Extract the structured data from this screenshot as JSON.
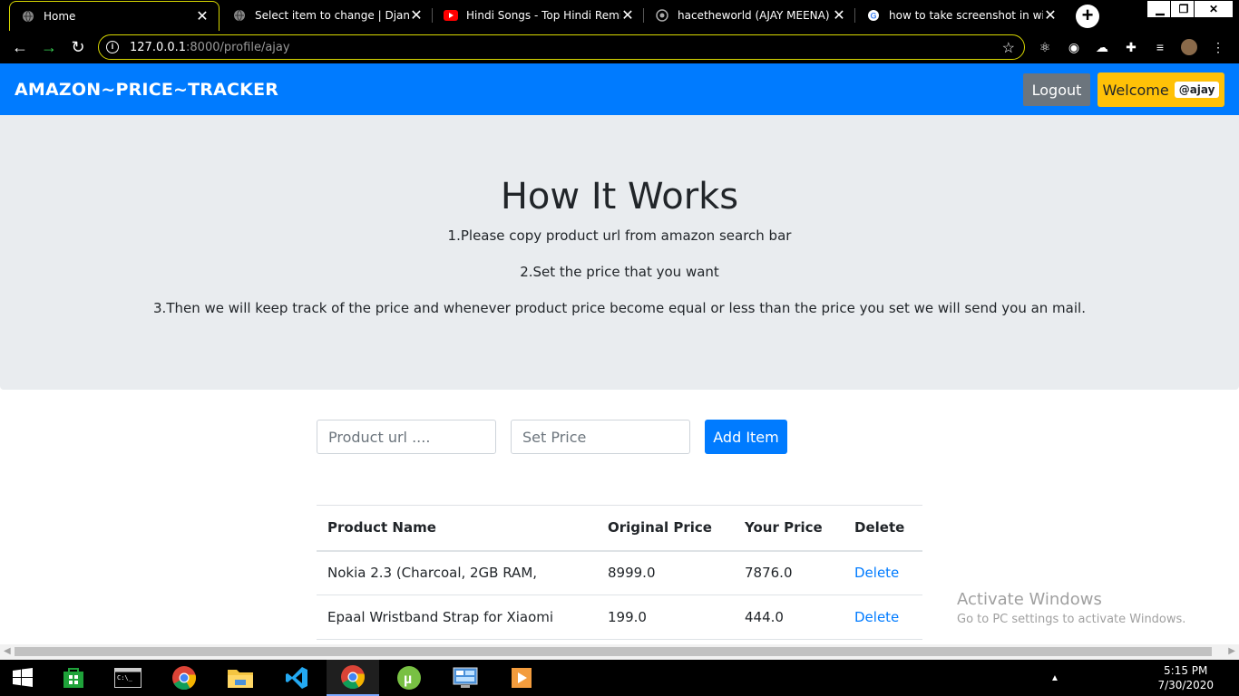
{
  "browser": {
    "tabs": [
      {
        "title": "Home",
        "icon": "globe-icon",
        "active": true
      },
      {
        "title": "Select item to change | Django admin",
        "icon": "globe-icon",
        "active": false
      },
      {
        "title": "Hindi Songs - Top Hindi Remix Songs",
        "icon": "youtube-icon",
        "active": false
      },
      {
        "title": "hacetheworld (AJAY MEENA)",
        "icon": "github-icon",
        "active": false
      },
      {
        "title": "how to take screenshot in windows",
        "icon": "google-icon",
        "active": false
      }
    ],
    "url_host": "127.0.0.1",
    "url_path": ":8000/profile/ajay"
  },
  "navbar": {
    "brand": "AMAZON~PRICE~TRACKER",
    "logout_label": "Logout",
    "welcome_label": "Welcome",
    "username_badge": "@ajay"
  },
  "jumbotron": {
    "title": "How It Works",
    "step1": "1.Please copy product url from amazon search bar",
    "step2": "2.Set the price that you want",
    "step3": "3.Then we will keep track of the price and whenever product price become equal or less than the price you set we will send you an mail."
  },
  "form": {
    "url_placeholder": "Product url ....",
    "price_placeholder": "Set Price",
    "add_label": "Add Item"
  },
  "table": {
    "headers": [
      "Product Name",
      "Original Price",
      "Your Price",
      "Delete"
    ],
    "rows": [
      {
        "name": "Nokia 2.3 (Charcoal, 2GB RAM,",
        "original": "8999.0",
        "yours": "7876.0",
        "action": "Delete"
      },
      {
        "name": "Epaal Wristband Strap for Xiaomi",
        "original": "199.0",
        "yours": "444.0",
        "action": "Delete"
      }
    ]
  },
  "watermark": {
    "line1": "Activate Windows",
    "line2": "Go to PC settings to activate Windows."
  },
  "taskbar": {
    "time": "5:15 PM",
    "date": "7/30/2020"
  },
  "colors": {
    "primary": "#007bff",
    "warning": "#ffc107",
    "secondary": "#6c757d",
    "jumbotron_bg": "#e9ecef"
  }
}
